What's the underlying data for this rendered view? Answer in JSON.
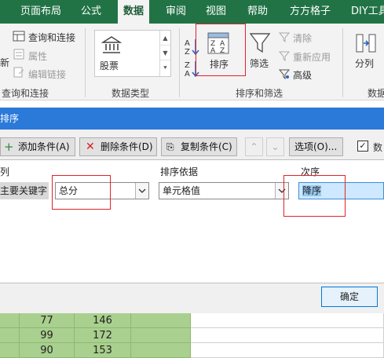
{
  "ribbon_tabs": [
    "页面布局",
    "公式",
    "数据",
    "审阅",
    "视图",
    "帮助",
    "方方格子",
    "DIY工具"
  ],
  "ribbon": {
    "query_group": {
      "items": [
        "查询和连接",
        "属性",
        "编辑链接"
      ],
      "left_fragment": "新",
      "label": "查询和连接"
    },
    "data_types_group": {
      "stock": "股票",
      "label": "数据类型"
    },
    "sort_group": {
      "sort": "排序",
      "filter": "筛选",
      "clear": "清除",
      "reapply": "重新应用",
      "advanced": "高级",
      "label": "排序和筛选"
    },
    "split": "分列",
    "right_fragment": "数据"
  },
  "dialog": {
    "title": "排序",
    "toolbar": {
      "add_level": "添加条件(A)",
      "delete_level": "删除条件(D)",
      "copy_level": "复制条件(C)",
      "options": "选项(O)...",
      "header_checkbox_fragment": "数"
    },
    "columns": {
      "column": "列",
      "sort_on": "排序依据",
      "order": "次序"
    },
    "row": {
      "label": "主要关键字",
      "column_value": "总分",
      "sort_on_value": "单元格值",
      "order_value": "降序"
    },
    "ok": "确定"
  },
  "sheet": {
    "rows": [
      [
        "77",
        "146"
      ],
      [
        "99",
        "172"
      ],
      [
        "90",
        "153"
      ]
    ]
  },
  "colors": {
    "ribbon_green": "#217346",
    "dialog_title_blue": "#2b79d9",
    "highlight_red": "#e2222b",
    "cell_green": "#a9d08e"
  }
}
